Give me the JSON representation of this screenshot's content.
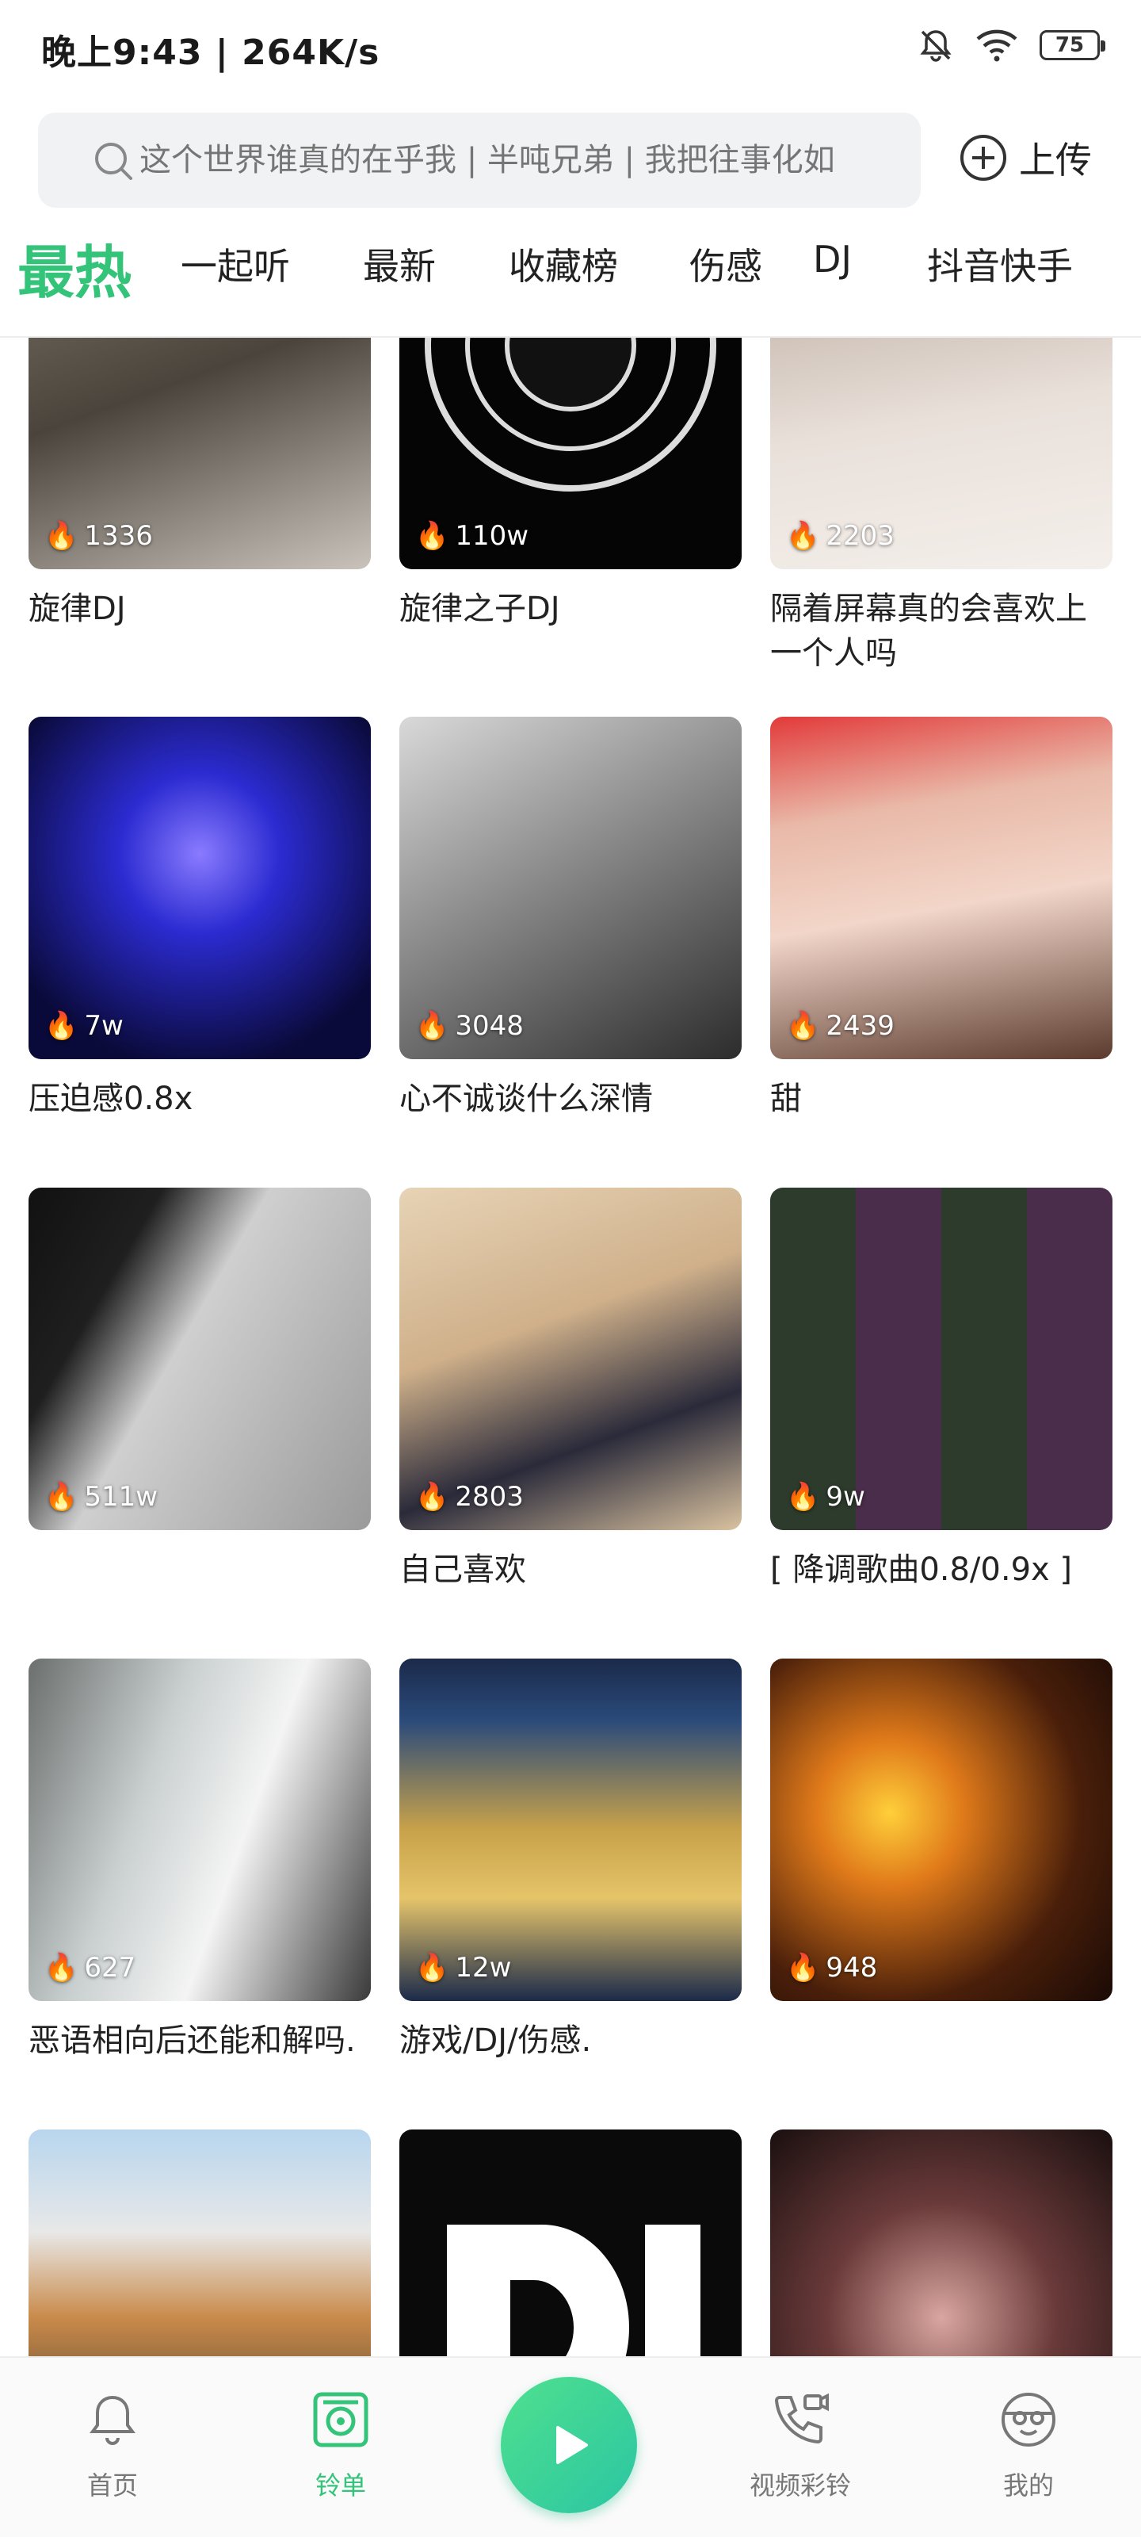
{
  "status_bar": {
    "time_speed": "晚上9:43 | 264K/s",
    "battery": "75"
  },
  "search": {
    "placeholder": "这个世界谁真的在乎我 | 半吨兄弟 | 我把往事化如"
  },
  "upload": {
    "label": "上传"
  },
  "tabs": [
    {
      "label": "最热",
      "active": true
    },
    {
      "label": "一起听"
    },
    {
      "label": "最新"
    },
    {
      "label": "收藏榜"
    },
    {
      "label": "伤感"
    },
    {
      "label": "DJ"
    },
    {
      "label": "抖音快手"
    }
  ],
  "cards": [
    {
      "count": "1336",
      "title": "旋律DJ"
    },
    {
      "count": "110w",
      "title": "旋律之子DJ"
    },
    {
      "count": "2203",
      "title": "隔着屏幕真的会喜欢上一个人吗"
    },
    {
      "count": "7w",
      "title": "压迫感0.8x"
    },
    {
      "count": "3048",
      "title": "心不诚谈什么深情"
    },
    {
      "count": "2439",
      "title": "甜"
    },
    {
      "count": "511w",
      "title": ""
    },
    {
      "count": "2803",
      "title": "自己喜欢"
    },
    {
      "count": "9w",
      "title": "[ 降调歌曲0.8/0.9x ]"
    },
    {
      "count": "627",
      "title": "恶语相向后还能和解吗."
    },
    {
      "count": "12w",
      "title": "游戏/DJ/伤感."
    },
    {
      "count": "948",
      "title": ""
    },
    {
      "count": "",
      "title": ""
    },
    {
      "count": "",
      "title": ""
    },
    {
      "count": "",
      "title": ""
    }
  ],
  "bottom_nav": {
    "home": "首页",
    "playlist": "铃单",
    "video_ringtone": "视频彩铃",
    "mine": "我的"
  },
  "colors": {
    "accent": "#33c47a"
  }
}
